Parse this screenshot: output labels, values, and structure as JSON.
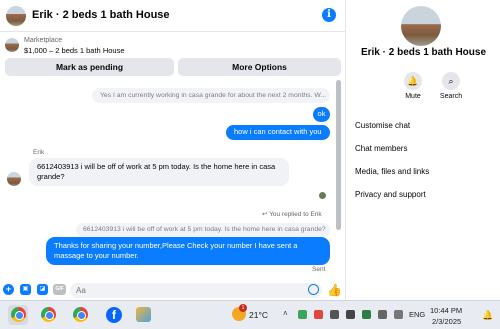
{
  "chat": {
    "title": "Erik · 2 beds 1 bath House",
    "info_icon": "i",
    "listing_label": "Marketplace",
    "listing_name": "$1,000 – 2 beds 1 bath House",
    "mark_pending": "Mark as pending",
    "more_options": "More Options"
  },
  "messages": {
    "m1": "Yes I am currently working in casa grande for about the next 2 months. W...",
    "m2": "ok",
    "m3": "how i can contact with you",
    "sender": "Erik",
    "m4": "6612403913 i will be off of work at 5 pm today. Is the home here in casa grande?",
    "replied": "You replied to Erik",
    "m5": "6612403913 i will be off of work at 5 pm today. Is the home here in casa grande?",
    "m6": "Thanks for sharing your number,Please Check your number I have sent a massage to your number.",
    "status": "Sent"
  },
  "composer": {
    "placeholder": "Aa",
    "plus": "+",
    "like": "👍"
  },
  "panel": {
    "title": "Erik · 2 beds 1 bath House",
    "mute_label": "Mute",
    "search_label": "Search",
    "menu": [
      "Customise chat",
      "Chat members",
      "Media, files and links",
      "Privacy and support"
    ]
  },
  "taskbar": {
    "fb_letter": "f",
    "weather_badge": "1",
    "temperature": "21°C",
    "language": "ENG",
    "time": "10:44 PM",
    "date": "2/3/2025"
  },
  "icons": [
    "info-icon",
    "plus-icon",
    "image-icon",
    "sticker-icon",
    "gif-icon",
    "emoji-icon",
    "like-icon",
    "bell-icon",
    "search-icon",
    "chrome-icon",
    "facebook-icon",
    "weather-icon"
  ]
}
